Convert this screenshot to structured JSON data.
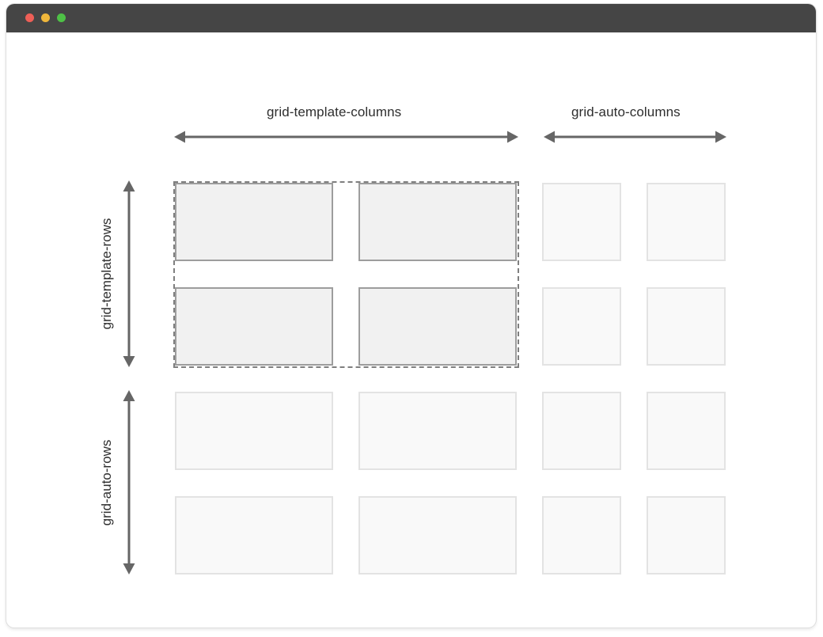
{
  "window": {
    "controls": [
      {
        "name": "close-dot",
        "color": "#ee5f57"
      },
      {
        "name": "minimize-dot",
        "color": "#f0b73b"
      },
      {
        "name": "zoom-dot",
        "color": "#4ec146"
      }
    ]
  },
  "labels": {
    "template_columns": "grid-template-columns",
    "auto_columns": "grid-auto-columns",
    "template_rows": "grid-template-rows",
    "auto_rows": "grid-auto-rows"
  },
  "grid": {
    "template_columns": 2,
    "auto_columns": 2,
    "template_rows": 2,
    "auto_rows": 2
  },
  "colors": {
    "arrow": "#666666",
    "template_cell_fill": "#f1f1f1",
    "template_cell_border": "#9d9d9d",
    "auto_cell_fill": "#f9f9f9",
    "auto_cell_border": "#e3e3e3",
    "explicit_grid_outline": "#7f7f7f"
  }
}
